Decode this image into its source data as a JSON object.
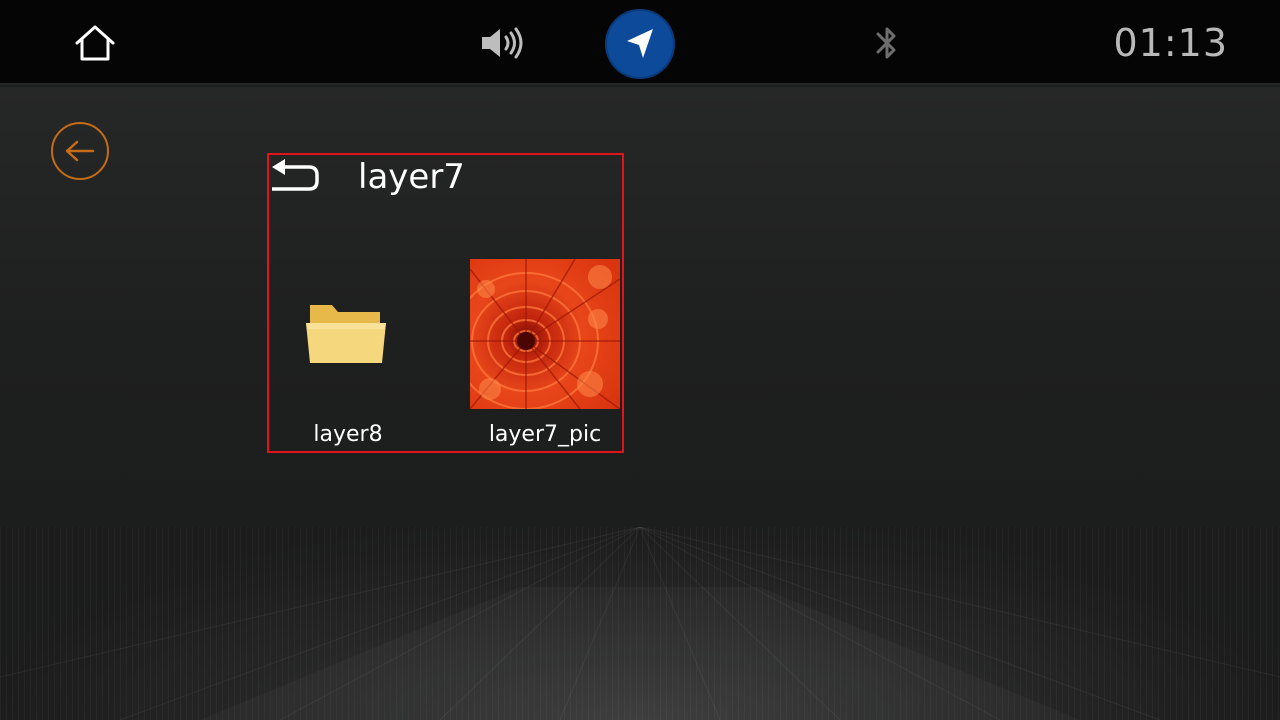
{
  "status_bar": {
    "icons": {
      "home": "home-icon",
      "volume": "speaker-volume-icon",
      "navigation": "navigation-arrow-icon",
      "bluetooth": "bluetooth-icon"
    },
    "clock": "01:13",
    "colors": {
      "background": "#050505",
      "nav_accent": "#0d4b9a",
      "clock_text": "#b9b9b9"
    }
  },
  "main": {
    "back_icon": "back-arrow-circle-icon",
    "accent_color": "#c56c16",
    "file_browser": {
      "current_folder": "layer7",
      "up_icon": "return-arrow-icon",
      "highlight_color": "#e0141b",
      "items": [
        {
          "name": "layer8",
          "type": "folder",
          "icon": "folder-icon"
        },
        {
          "name": "layer7_pic",
          "type": "image",
          "icon": "image-thumbnail"
        }
      ]
    }
  }
}
